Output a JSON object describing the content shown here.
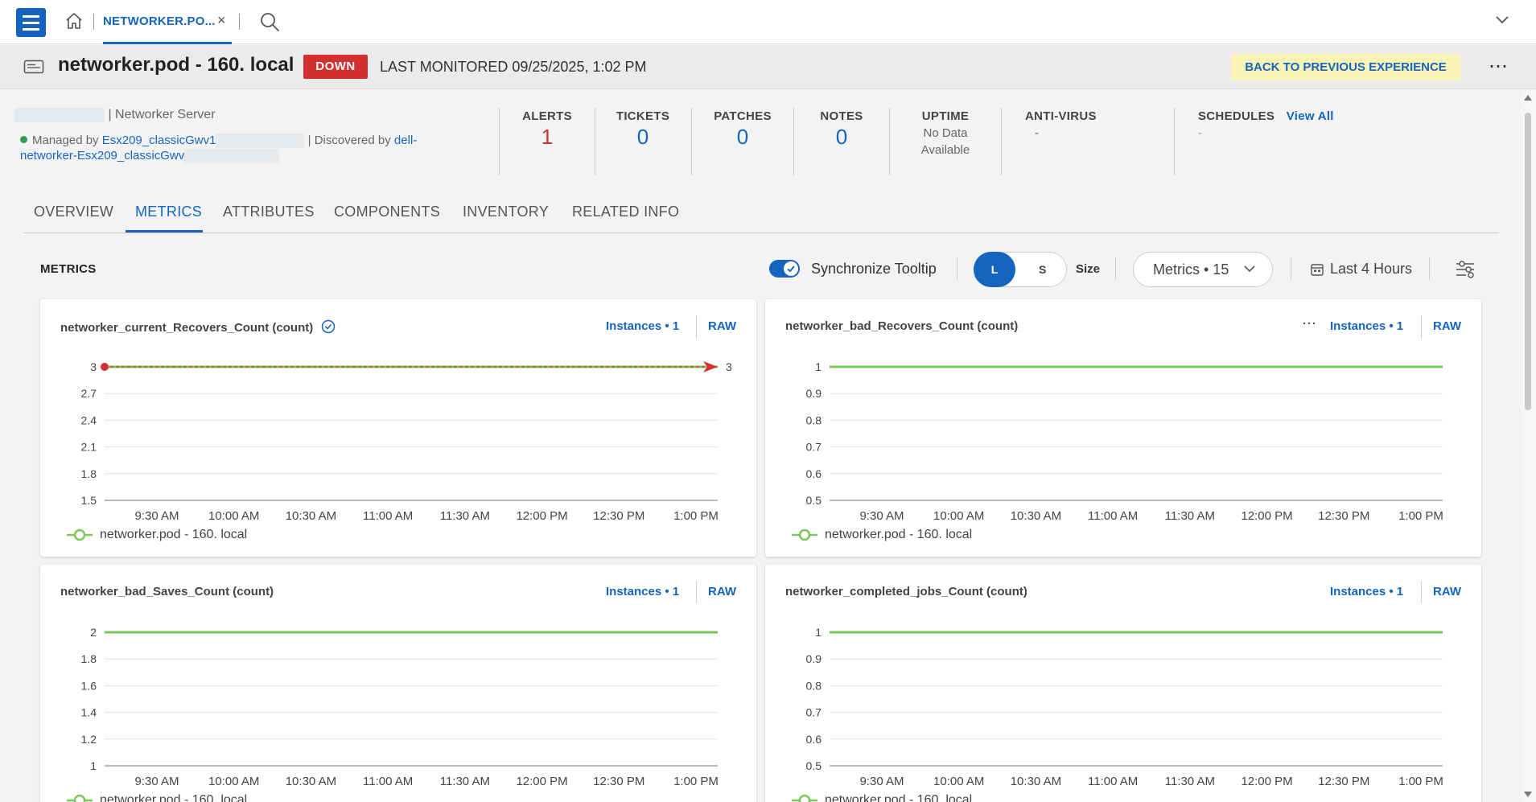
{
  "tabbar": {
    "active_tab": "NETWORKER.PO...",
    "close_glyph": "×"
  },
  "device": {
    "title": "networker.pod - 160. local",
    "status": "DOWN",
    "last_monitored": "LAST MONITORED 09/25/2025, 1:02 PM",
    "back_button": "BACK TO PREVIOUS EXPERIENCE",
    "more_glyph": "⋯",
    "server_type": "| Networker Server",
    "managed_prefix": "Managed by ",
    "managed_link": "Esx209_classicGwv1",
    "discovered_prefix": " | Discovered by ",
    "discovered_link": "dell-",
    "discovered_link2": "networker-Esx209_classicGwv"
  },
  "stats": {
    "alerts": {
      "label": "ALERTS",
      "value": "1"
    },
    "tickets": {
      "label": "TICKETS",
      "value": "0"
    },
    "patches": {
      "label": "PATCHES",
      "value": "0"
    },
    "notes": {
      "label": "NOTES",
      "value": "0"
    },
    "uptime": {
      "label": "UPTIME",
      "line1": "No Data",
      "line2": "Available"
    },
    "antivirus": {
      "label": "ANTI-VIRUS",
      "value": "-"
    },
    "schedules": {
      "label": "SCHEDULES",
      "link": "View All",
      "value": "-"
    }
  },
  "tabs": [
    "OVERVIEW",
    "METRICS",
    "ATTRIBUTES",
    "COMPONENTS",
    "INVENTORY",
    "RELATED INFO"
  ],
  "metrics_toolbar": {
    "title": "METRICS",
    "sync_label": "Synchronize Tooltip",
    "size_l": "L",
    "size_s": "S",
    "size_label": "Size",
    "metrics_dropdown": "Metrics • 15",
    "time_range": "Last 4 Hours"
  },
  "colors": {
    "brand": "#1565c0",
    "down": "#d32f2f",
    "series_green": "#7cc65a",
    "highlight_red": "#d32f2f"
  },
  "cards": [
    {
      "title": "networker_current_Recovers_Count (count)",
      "instances": "Instances • 1",
      "raw": "RAW",
      "legend": "networker.pod - 160. local"
    },
    {
      "title": "networker_bad_Recovers_Count (count)",
      "instances": "Instances • 1",
      "raw": "RAW",
      "legend": "networker.pod - 160. local"
    },
    {
      "title": "networker_bad_Saves_Count (count)",
      "instances": "Instances • 1",
      "raw": "RAW",
      "legend": "networker.pod - 160. local"
    },
    {
      "title": "networker_completed_jobs_Count (count)",
      "instances": "Instances • 1",
      "raw": "RAW",
      "legend": "networker.pod - 160. local"
    }
  ],
  "chart_data": [
    {
      "type": "line",
      "x": [
        "9:30 AM",
        "10:00 AM",
        "10:30 AM",
        "11:00 AM",
        "11:30 AM",
        "12:00 PM",
        "12:30 PM",
        "1:00 PM"
      ],
      "yticks": [
        "3",
        "2.7",
        "2.4",
        "2.1",
        "1.8",
        "1.5"
      ],
      "ylim": [
        1.5,
        3
      ],
      "series": [
        {
          "values": [
            3,
            3,
            3,
            3,
            3,
            3,
            3,
            3
          ]
        }
      ],
      "annotation": "3"
    },
    {
      "type": "line",
      "x": [
        "9:30 AM",
        "10:00 AM",
        "10:30 AM",
        "11:00 AM",
        "11:30 AM",
        "12:00 PM",
        "12:30 PM",
        "1:00 PM"
      ],
      "yticks": [
        "1",
        "0.9",
        "0.8",
        "0.7",
        "0.6",
        "0.5"
      ],
      "ylim": [
        0.5,
        1
      ],
      "series": [
        {
          "values": [
            1,
            1,
            1,
            1,
            1,
            1,
            1,
            1
          ]
        }
      ]
    },
    {
      "type": "line",
      "x": [
        "9:30 AM",
        "10:00 AM",
        "10:30 AM",
        "11:00 AM",
        "11:30 AM",
        "12:00 PM",
        "12:30 PM",
        "1:00 PM"
      ],
      "yticks": [
        "2",
        "1.8",
        "1.6",
        "1.4",
        "1.2",
        "1"
      ],
      "ylim": [
        1,
        2
      ],
      "series": [
        {
          "values": [
            2,
            2,
            2,
            2,
            2,
            2,
            2,
            2
          ]
        }
      ]
    },
    {
      "type": "line",
      "x": [
        "9:30 AM",
        "10:00 AM",
        "10:30 AM",
        "11:00 AM",
        "11:30 AM",
        "12:00 PM",
        "12:30 PM",
        "1:00 PM"
      ],
      "yticks": [
        "1",
        "0.9",
        "0.8",
        "0.7",
        "0.6",
        "0.5"
      ],
      "ylim": [
        0.5,
        1
      ],
      "series": [
        {
          "values": [
            1,
            1,
            1,
            1,
            1,
            1,
            1,
            1
          ]
        }
      ]
    }
  ]
}
